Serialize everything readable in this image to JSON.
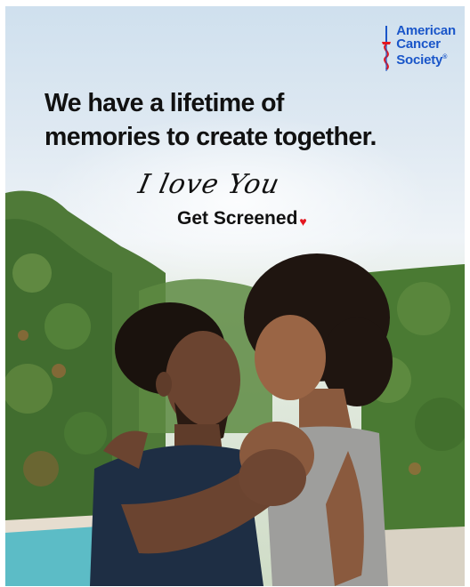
{
  "logo": {
    "line1": "American",
    "line2": "Cancer",
    "line3": "Society",
    "registered": "®",
    "icon": "sword-icon"
  },
  "headline": {
    "line1": "We have a lifetime of",
    "line2": "memories to create together."
  },
  "script_text": "I love You",
  "cta": {
    "label": "Get Screened",
    "icon": "heart-icon"
  },
  "colors": {
    "brand_blue": "#1a56c9",
    "heart_red": "#e4161f",
    "text": "#111111"
  }
}
